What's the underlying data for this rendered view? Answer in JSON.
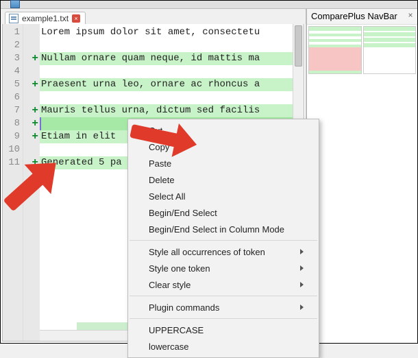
{
  "toolbar": {
    "icon": "save-icon"
  },
  "tab": {
    "filename": "example1.txt",
    "close": "×"
  },
  "side": {
    "title": "ComparePlus NavBar",
    "close": "×"
  },
  "editor": {
    "lines": [
      {
        "num": "1",
        "mark": "",
        "class": "",
        "text": "Lorem ipsum dolor sit amet, consectetu"
      },
      {
        "num": "2",
        "mark": "",
        "class": "",
        "text": ""
      },
      {
        "num": "3",
        "mark": "+",
        "class": "added",
        "text": "Nullam ornare quam neque, id mattis ma"
      },
      {
        "num": "4",
        "mark": "",
        "class": "",
        "text": ""
      },
      {
        "num": "5",
        "mark": "+",
        "class": "added",
        "text": "Praesent urna leo, ornare ac rhoncus a"
      },
      {
        "num": "6",
        "mark": "",
        "class": "",
        "text": ""
      },
      {
        "num": "7",
        "mark": "+",
        "class": "added",
        "text": "Mauris tellus urna, dictum sed facilis"
      },
      {
        "num": "8",
        "mark": "+",
        "class": "hl cursor",
        "text": ""
      },
      {
        "num": "9",
        "mark": "+",
        "class": "added",
        "text": "Etiam in elit "
      },
      {
        "num": "10",
        "mark": "",
        "class": "",
        "text": ""
      },
      {
        "num": "11",
        "mark": "+",
        "class": "added",
        "text": "Generated 5 pa"
      }
    ]
  },
  "menu": {
    "group1": [
      {
        "label": "Cut",
        "sub": false
      },
      {
        "label": "Copy",
        "sub": false
      },
      {
        "label": "Paste",
        "sub": false
      },
      {
        "label": "Delete",
        "sub": false
      },
      {
        "label": "Select All",
        "sub": false
      },
      {
        "label": "Begin/End Select",
        "sub": false
      },
      {
        "label": "Begin/End Select in Column Mode",
        "sub": false
      }
    ],
    "group2": [
      {
        "label": "Style all occurrences of token",
        "sub": true
      },
      {
        "label": "Style one token",
        "sub": true
      },
      {
        "label": "Clear style",
        "sub": true
      }
    ],
    "group3": [
      {
        "label": "Plugin commands",
        "sub": true
      }
    ],
    "group4": [
      {
        "label": "UPPERCASE",
        "sub": false
      },
      {
        "label": "lowercase",
        "sub": false
      }
    ]
  },
  "colors": {
    "diff_added": "#c8f3c8",
    "diff_removed": "#f6c5c4",
    "arrow": "#e03b2a"
  },
  "chart_data": null
}
